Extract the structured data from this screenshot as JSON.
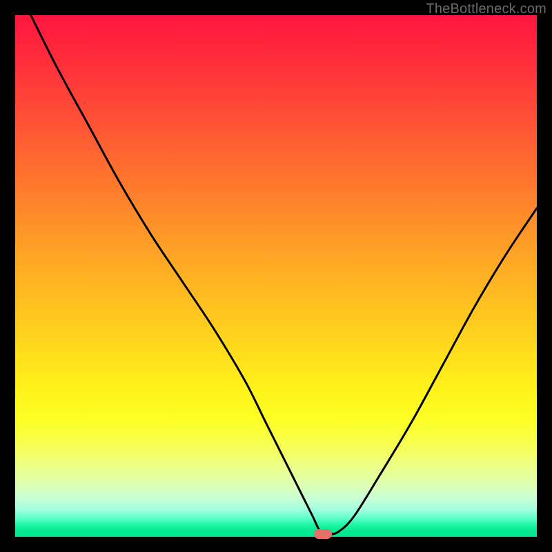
{
  "watermark": "TheBottleneck.com",
  "chart_data": {
    "type": "line",
    "title": "",
    "xlabel": "",
    "ylabel": "",
    "xlim": [
      0,
      100
    ],
    "ylim": [
      0,
      100
    ],
    "grid": false,
    "legend": false,
    "series": [
      {
        "name": "bottleneck-curve",
        "x": [
          3,
          8,
          14,
          20,
          26,
          32,
          38,
          44,
          48,
          52,
          55,
          57,
          58.5,
          60,
          62,
          65,
          70,
          76,
          82,
          88,
          94,
          100
        ],
        "y": [
          100,
          90,
          79,
          68,
          58,
          49,
          40,
          30,
          22,
          14,
          8,
          4,
          1,
          0.5,
          1,
          4,
          12,
          22,
          33,
          44,
          54,
          63
        ]
      }
    ],
    "marker": {
      "x": 59,
      "y": 0.5
    },
    "colors": {
      "curve": "#000000",
      "marker": "#e76f6a",
      "gradient_top": "#ff153f",
      "gradient_bottom": "#04e48f"
    }
  }
}
